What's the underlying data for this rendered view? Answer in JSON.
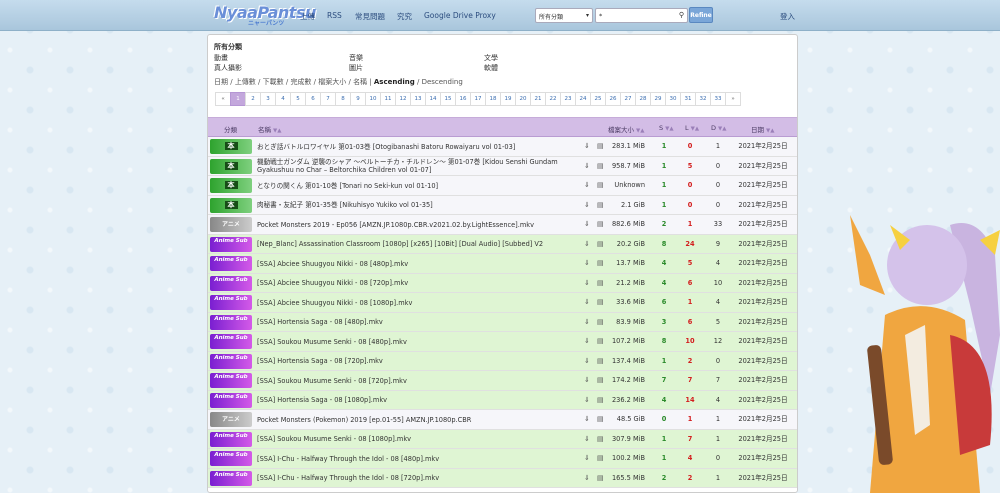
{
  "nav": {
    "brand": "NyaaPantsu",
    "brand_sub": "ニャーパンツ",
    "links": [
      "上傳",
      "RSS",
      "常見問題",
      "究究",
      "Google Drive Proxy"
    ],
    "category_select": "所有分類",
    "search_value": "*",
    "refine_label": "Refine",
    "login_label": "登入"
  },
  "filters": {
    "heading": "所有分類",
    "col1": [
      "動畫",
      "真人攝影"
    ],
    "col2": [
      "音樂",
      "圖片"
    ],
    "col3": [
      "文學",
      "軟體"
    ]
  },
  "sort": {
    "options": [
      "日期",
      "上傳數",
      "下載數",
      "完成數",
      "檔案大小",
      "名稱"
    ],
    "ascending": "Ascending",
    "descending": "Descending"
  },
  "pager": {
    "prev": "«",
    "next": "»",
    "pages": [
      "1",
      "2",
      "3",
      "4",
      "5",
      "6",
      "7",
      "8",
      "9",
      "10",
      "11",
      "12",
      "13",
      "14",
      "15",
      "16",
      "17",
      "18",
      "19",
      "20",
      "21",
      "22",
      "23",
      "24",
      "25",
      "26",
      "27",
      "28",
      "29",
      "30",
      "31",
      "32",
      "33"
    ],
    "active": "1"
  },
  "table": {
    "headers": {
      "category": "分類",
      "name": "名稱",
      "size": "檔案大小",
      "seeders": "S",
      "leechers": "L",
      "downloads": "D",
      "date": "日期"
    },
    "rows": [
      {
        "cat": "book",
        "cat_label": "本",
        "name": "おとぎ話バトルロワイヤル 第01-03巻 [Otogibanashi Batoru Rowaiyaru vol 01-03]",
        "size": "283.1 MiB",
        "s": "1",
        "l": "0",
        "d": "1",
        "date": "2021年2月25日",
        "status": "normal"
      },
      {
        "cat": "book",
        "cat_label": "本",
        "name": "機動戦士ガンダム 逆襲のシャア ～ベルトーチカ・チルドレン～ 第01-07巻 [Kidou Senshi Gundam Gyakushuu no Char – Beltorchika Children vol 01-07]",
        "size": "958.7 MiB",
        "s": "1",
        "l": "5",
        "d": "0",
        "date": "2021年2月25日",
        "status": "normal"
      },
      {
        "cat": "book",
        "cat_label": "本",
        "name": "となりの関くん 第01-10巻 [Tonari no Seki-kun vol 01-10]",
        "size": "Unknown",
        "s": "1",
        "l": "0",
        "d": "0",
        "date": "2021年2月25日",
        "status": "normal"
      },
      {
        "cat": "book",
        "cat_label": "本",
        "name": "肉秘書・友紀子 第01-35巻 [Nikuhisyo Yukiko vol 01-35]",
        "size": "2.1 GiB",
        "s": "1",
        "l": "0",
        "d": "0",
        "date": "2021年2月25日",
        "status": "normal"
      },
      {
        "cat": "raw",
        "cat_label": "アニメ",
        "name": "Pocket Monsters 2019 - Ep056 [AMZN.JP.1080p.CBR.v2021.02.by.LightEssence].mkv",
        "size": "882.6 MiB",
        "s": "2",
        "l": "1",
        "d": "33",
        "date": "2021年2月25日",
        "status": "normal"
      },
      {
        "cat": "sub",
        "cat_label": "Anime Sub",
        "name": "[Nep_Blanc] Assassination Classroom [1080p] [x265] [10Bit] [Dual Audio] [Subbed] V2",
        "size": "20.2 GiB",
        "s": "8",
        "l": "24",
        "d": "9",
        "date": "2021年2月25日",
        "status": "success"
      },
      {
        "cat": "sub",
        "cat_label": "Anime Sub",
        "name": "[SSA] Abciee Shuugyou Nikki - 08 [480p].mkv",
        "size": "13.7 MiB",
        "s": "4",
        "l": "5",
        "d": "4",
        "date": "2021年2月25日",
        "status": "success"
      },
      {
        "cat": "sub",
        "cat_label": "Anime Sub",
        "name": "[SSA] Abciee Shuugyou Nikki - 08 [720p].mkv",
        "size": "21.2 MiB",
        "s": "4",
        "l": "6",
        "d": "10",
        "date": "2021年2月25日",
        "status": "success"
      },
      {
        "cat": "sub",
        "cat_label": "Anime Sub",
        "name": "[SSA] Abciee Shuugyou Nikki - 08 [1080p].mkv",
        "size": "33.6 MiB",
        "s": "6",
        "l": "1",
        "d": "4",
        "date": "2021年2月25日",
        "status": "success"
      },
      {
        "cat": "sub",
        "cat_label": "Anime Sub",
        "name": "[SSA] Hortensia Saga - 08 [480p].mkv",
        "size": "83.9 MiB",
        "s": "3",
        "l": "6",
        "d": "5",
        "date": "2021年2月25日",
        "status": "success"
      },
      {
        "cat": "sub",
        "cat_label": "Anime Sub",
        "name": "[SSA] Soukou Musume Senki - 08 [480p].mkv",
        "size": "107.2 MiB",
        "s": "8",
        "l": "10",
        "d": "12",
        "date": "2021年2月25日",
        "status": "success"
      },
      {
        "cat": "sub",
        "cat_label": "Anime Sub",
        "name": "[SSA] Hortensia Saga - 08 [720p].mkv",
        "size": "137.4 MiB",
        "s": "1",
        "l": "2",
        "d": "0",
        "date": "2021年2月25日",
        "status": "success"
      },
      {
        "cat": "sub",
        "cat_label": "Anime Sub",
        "name": "[SSA] Soukou Musume Senki - 08 [720p].mkv",
        "size": "174.2 MiB",
        "s": "7",
        "l": "7",
        "d": "7",
        "date": "2021年2月25日",
        "status": "success"
      },
      {
        "cat": "sub",
        "cat_label": "Anime Sub",
        "name": "[SSA] Hortensia Saga - 08 [1080p].mkv",
        "size": "236.2 MiB",
        "s": "4",
        "l": "14",
        "d": "4",
        "date": "2021年2月25日",
        "status": "success"
      },
      {
        "cat": "raw",
        "cat_label": "アニメ",
        "name": "Pocket Monsters (Pokemon) 2019 [ep.01-55] AMZN.JP.1080p.CBR",
        "size": "48.5 GiB",
        "s": "0",
        "l": "1",
        "d": "1",
        "date": "2021年2月25日",
        "status": "normal"
      },
      {
        "cat": "sub",
        "cat_label": "Anime Sub",
        "name": "[SSA] Soukou Musume Senki - 08 [1080p].mkv",
        "size": "307.9 MiB",
        "s": "1",
        "l": "7",
        "d": "1",
        "date": "2021年2月25日",
        "status": "success"
      },
      {
        "cat": "sub",
        "cat_label": "Anime Sub",
        "name": "[SSA] I-Chu - Halfway Through the Idol - 08 [480p].mkv",
        "size": "100.2 MiB",
        "s": "1",
        "l": "4",
        "d": "0",
        "date": "2021年2月25日",
        "status": "success"
      },
      {
        "cat": "sub",
        "cat_label": "Anime Sub",
        "name": "[SSA] I-Chu - Halfway Through the Idol - 08 [720p].mkv",
        "size": "165.5 MiB",
        "s": "2",
        "l": "2",
        "d": "1",
        "date": "2021年2月25日",
        "status": "success"
      }
    ]
  }
}
